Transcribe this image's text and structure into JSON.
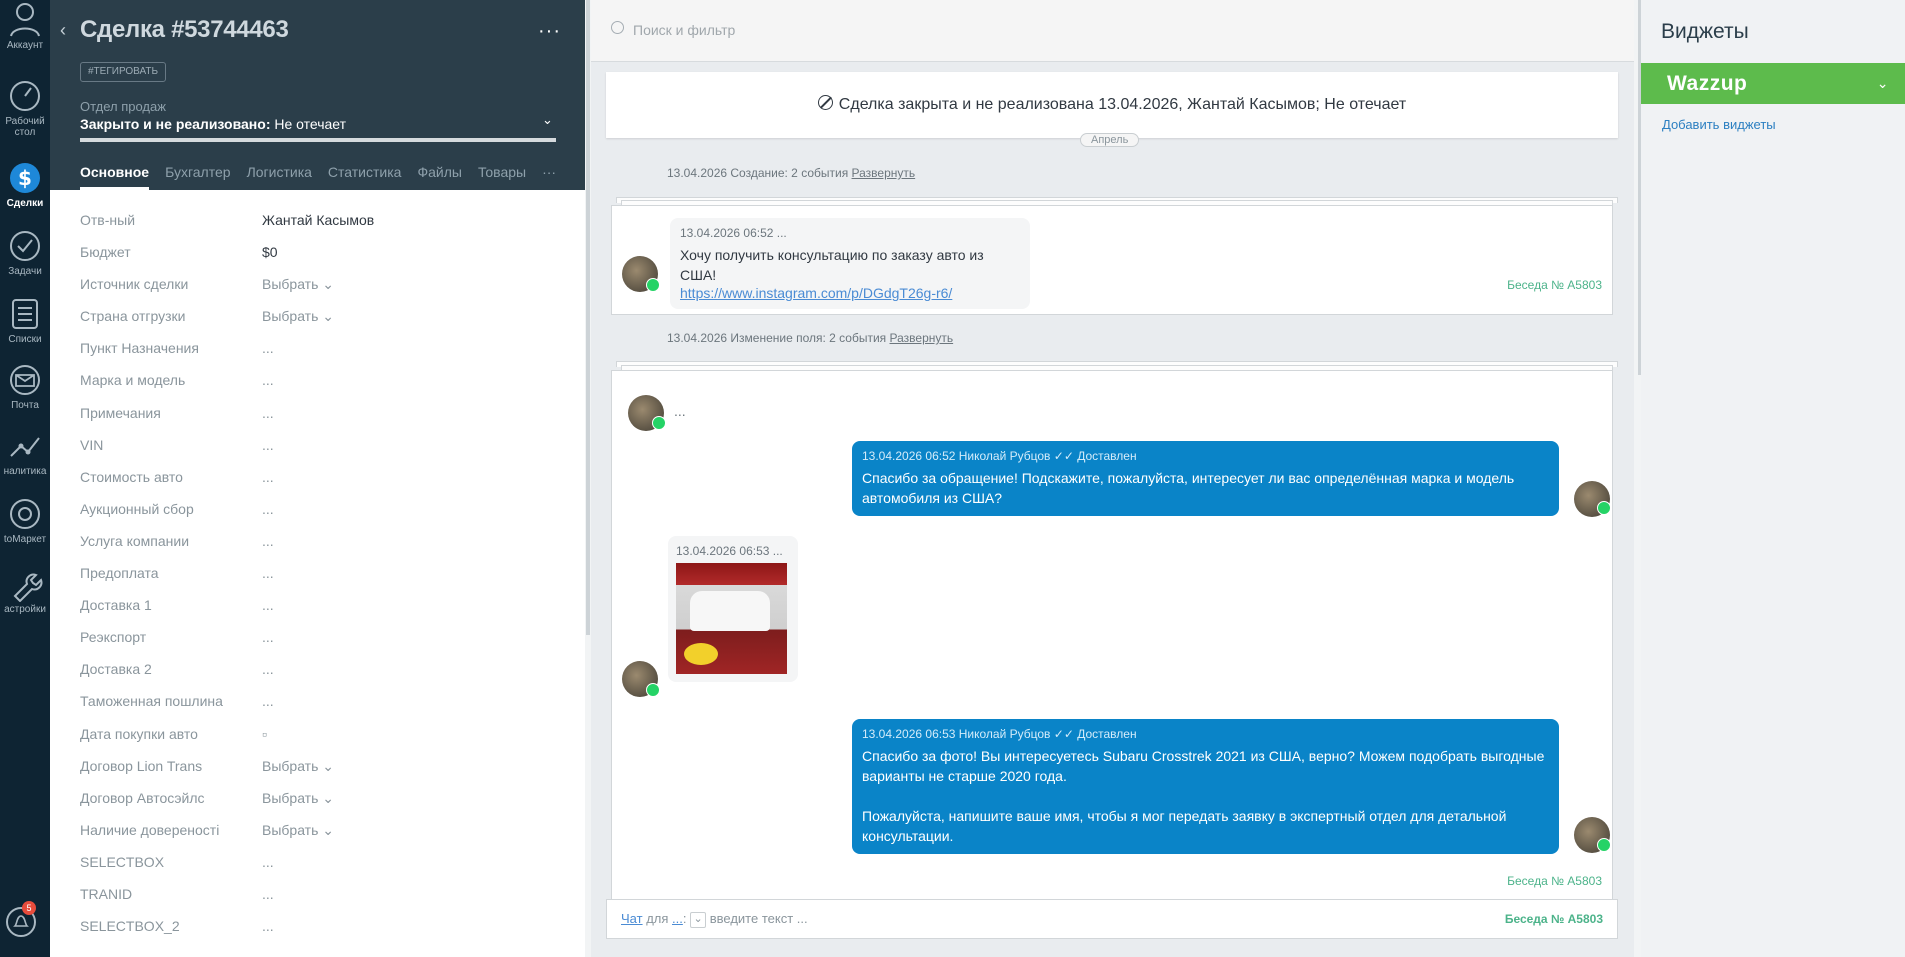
{
  "nav": {
    "items": [
      {
        "label": "Аккаунт"
      },
      {
        "label": "Рабочий стол"
      },
      {
        "label": "Сделки"
      },
      {
        "label": "Задачи"
      },
      {
        "label": "Списки"
      },
      {
        "label": "Почта"
      },
      {
        "label": "налитика"
      },
      {
        "label": "tоМаркет"
      },
      {
        "label": "астройки"
      }
    ],
    "notifications_count": "5"
  },
  "card": {
    "title": "Сделка #53744463",
    "more": "···",
    "tag_button": "#ТЕГИРОВАТЬ",
    "pipeline": "Отдел продаж",
    "status_bold": "Закрыто и не реализовано:",
    "status_reason": " Не отечает",
    "tabs": [
      "Основное",
      "Бухгалтер",
      "Логистика",
      "Статистика",
      "Файлы",
      "Товары",
      "···"
    ],
    "fields": [
      {
        "label": "Отв-ный",
        "value": "Жантай Касымов"
      },
      {
        "label": "Бюджет",
        "value": "$0"
      },
      {
        "label": "Источник сделки",
        "value": "Выбрать ⌄"
      },
      {
        "label": "Страна отгрузки",
        "value": "Выбрать ⌄"
      },
      {
        "label": "Пункт Назначения",
        "value": "..."
      },
      {
        "label": "Марка и модель",
        "value": "..."
      },
      {
        "label": "Примечания",
        "value": "..."
      },
      {
        "label": "VIN",
        "value": "..."
      },
      {
        "label": "Стоимость авто",
        "value": "..."
      },
      {
        "label": "Аукционный сбор",
        "value": "..."
      },
      {
        "label": "Услуга компании",
        "value": "..."
      },
      {
        "label": "Предоплата",
        "value": "..."
      },
      {
        "label": "Доставка 1",
        "value": "..."
      },
      {
        "label": "Реэкспорт",
        "value": "..."
      },
      {
        "label": "Доставка 2",
        "value": "..."
      },
      {
        "label": "Таможенная пошлина",
        "value": "..."
      },
      {
        "label": "Дата покупки авто",
        "value": "▫"
      },
      {
        "label": "Договор Lion Trans",
        "value": "Выбрать ⌄"
      },
      {
        "label": "Договор Автосэйлс",
        "value": "Выбрать ⌄"
      },
      {
        "label": "Наличие довереності",
        "value": "Выбрать ⌄"
      },
      {
        "label": "SELECTBOX",
        "value": "..."
      },
      {
        "label": "TRANID",
        "value": "..."
      },
      {
        "label": "SELECTBOX_2",
        "value": "..."
      }
    ]
  },
  "feed": {
    "search_placeholder": "Поиск и фильтр",
    "closed_banner": "Сделка закрыта и не реализована 13.04.2026, Жантай Касымов; Не отечает",
    "month_label": "Апрель",
    "event1": "13.04.2026 Создание: 2 события ",
    "event2": "13.04.2026 Изменение поля: 2 события ",
    "expand": "Развернуть",
    "msg1_meta": "13.04.2026 06:52 ...",
    "msg1_text": "Хочу получить консультацию по заказу авто из США!",
    "msg1_link": "https://www.instagram.com/p/DGdgT26g-r6/",
    "conversation": "Беседа № A5803",
    "ellipsis": "...",
    "msg2_meta": "13.04.2026 06:52 Николай Рубцов ✓✓ Доставлен",
    "msg2_text": "Спасибо за обращение! Подскажите, пожалуйста, интересует ли вас определённая марка и модель автомобиля из США?",
    "msg3_meta": "13.04.2026 06:53 ...",
    "msg4_meta": "13.04.2026 06:53 Николай Рубцов ✓✓ Доставлен",
    "msg4_text1": "Спасибо за фото! Вы интересуетесь Subaru Crosstrek 2021 из США, верно? Можем подобрать выгодные варианты не старше 2020 года.",
    "msg4_text2": "Пожалуйста, напишите ваше имя, чтобы я мог передать заявку в экспертный отдел для детальной консультации.",
    "input_chat": "Чат",
    "input_for": " для ",
    "input_target": "...",
    "input_placeholder": "введите текст ..."
  },
  "widgets": {
    "title": "Виджеты",
    "wazzup": "Wazzup",
    "add": "Добавить виджеты"
  }
}
